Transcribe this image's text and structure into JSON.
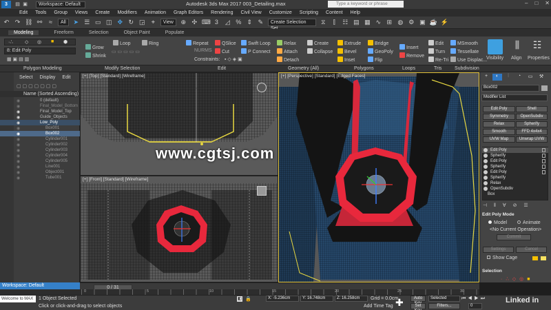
{
  "titlebar": {
    "workspace": "Workspace: Default",
    "title": "Autodesk 3ds Max 2017    003_Detailing.max",
    "search_placeholder": "Type a keyword or phrase",
    "logo": "3"
  },
  "menu": [
    "Edit",
    "Tools",
    "Group",
    "Views",
    "Create",
    "Modifiers",
    "Animation",
    "Graph Editors",
    "Rendering",
    "Civil View",
    "Customize",
    "Scripting",
    "Content",
    "Help"
  ],
  "toolbar": {
    "filter_all": "All",
    "ref_coord": "View",
    "selection_set": "Create Selection Set"
  },
  "ribbon_tabs": [
    "Modeling",
    "Freeform",
    "Selection",
    "Object Paint",
    "Populate"
  ],
  "ribbon": {
    "mode_label": "8: Edit Poly",
    "grow": "Grow",
    "shrink": "Shrink",
    "loop": "Loop",
    "ring": "Ring",
    "repeat": "Repeat",
    "nurms": "NURMS",
    "qslice": "QSlice",
    "swiftloop": "Swift Loop",
    "cut": "Cut",
    "pconnect": "P Connect",
    "constraints": "Constraints:",
    "relax": "Relax",
    "attach": "Attach",
    "detach": "Detach",
    "create": "Create",
    "collapse": "Collapse",
    "extrude": "Extrude",
    "bevel": "Bevel",
    "inset": "Inset",
    "bridge": "Bridge",
    "geopoly": "GeoPoly",
    "flip": "Flip",
    "insert": "Insert",
    "remove": "Remove",
    "edit": "Edit",
    "turn": "Turn",
    "retri": "Re-Tri",
    "msmooth": "MSmooth",
    "tessellate": "Tessellate",
    "usedisplac": "Use Displac...",
    "visibility": "Visibility",
    "align": "Align",
    "properties": "Properties"
  },
  "ribbon_groups": [
    "Polygon Modeling",
    "Modify Selection",
    "Edit",
    "Geometry (All)",
    "Polygons",
    "Loops",
    "Tris",
    "Subdivision"
  ],
  "explorer": {
    "tabs": [
      "Select",
      "Display",
      "Edit"
    ],
    "column": "Name (Sorted Ascending)",
    "items": [
      {
        "name": "0 (default)"
      },
      {
        "name": "Final_Model_Bottom"
      },
      {
        "name": "Final_Model_Top"
      },
      {
        "name": "Guide_Objects"
      },
      {
        "name": "Low_Poly"
      },
      {
        "name": "Box001"
      },
      {
        "name": "Box002"
      },
      {
        "name": "Cylinder001"
      },
      {
        "name": "Cylinder002"
      },
      {
        "name": "Cylinder003"
      },
      {
        "name": "Cylinder004"
      },
      {
        "name": "Cylinder005"
      },
      {
        "name": "Line001"
      },
      {
        "name": "Object001"
      },
      {
        "name": "Tube001"
      }
    ]
  },
  "viewports": {
    "top": "[+] [Top] [Standard] [Wireframe]",
    "front": "[+] [Front] [Standard] [Wireframe]",
    "persp": "[+] [Perspective] [Standard] [Edged Faces]"
  },
  "watermark": "www.cgtsj.com",
  "cmdpanel": {
    "object_name": "Box002",
    "modifier_list": "Modifier List",
    "buttons": [
      "Edit Poly",
      "Shell",
      "Symmetry",
      "OpenSubdiv",
      "Relax",
      "Spherify",
      "Smooth",
      "FFD 4x4x4",
      "UVW Map",
      "Unwrap UVW"
    ],
    "stack": [
      "Edit Poly",
      "Spherify",
      "Edit Poly",
      "Spherify",
      "Edit Poly",
      "Spherify",
      "Relax",
      "OpenSubdiv",
      "Box"
    ],
    "section_mode": "Edit Poly Mode",
    "model": "Model",
    "animate": "Animate",
    "no_op": "<No Current Operation>",
    "commit": "Commit",
    "settings": "Settings",
    "cancel": "Cancel",
    "show_cage": "Show Cage",
    "section_selection": "Selection"
  },
  "bottom": {
    "workspace": "Workspace: Default",
    "frame": "0 / 31",
    "ticks": [
      "0",
      "5",
      "10",
      "15",
      "20",
      "25",
      "30"
    ],
    "maxscript": "Welcome to MAX",
    "status1": "1 Object Selected",
    "status2": "Click or click-and-drag to select objects",
    "x": "X: -5.236cm",
    "y": "Y: 16.748cm",
    "z": "Z: 16.258cm",
    "grid": "Grid = 0.0cm",
    "add_time_tag": "Add Time Tag",
    "autokey": "Auto Key",
    "selected": "Selected",
    "setkey": "Set Key",
    "filters": "Filters...",
    "frame_num": "0"
  },
  "linkedin": "Linked in"
}
